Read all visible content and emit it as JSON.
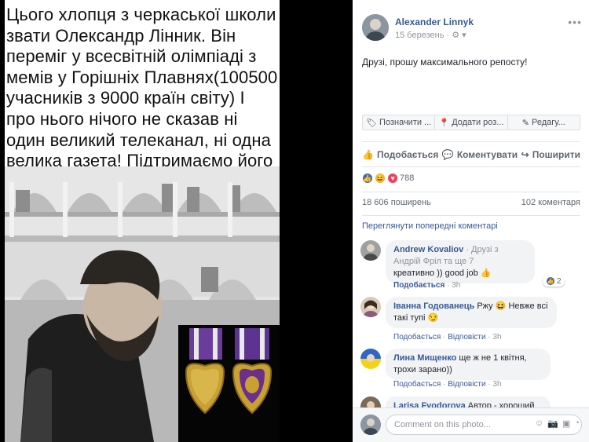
{
  "photo": {
    "caption": "Цього хлопця з черкаської школи звати Олександр Лінник. Він переміг у всесвітній олімпіаді з мемів у Горішніх Плавнях(100500 учасників з 9000 країн світу) І про нього нічого не сказав ні один великий телеканал, ні одна велика газета! Підтримаємо його репостами!"
  },
  "post": {
    "author": "Alexander Linnyk",
    "date": "15 березень",
    "text": "Друзі, прошу максимального репосту!",
    "photo_actions": [
      "Позначити ...",
      "Додати роз...",
      "Редагу..."
    ],
    "like_label": "Подобається",
    "comment_label": "Коментувати",
    "share_label": "Поширити",
    "reaction_count": "788",
    "shares": "18 606 поширень",
    "comments_count": "102 коментаря",
    "prev_comments": "Переглянути попередні коментарі"
  },
  "comments": [
    {
      "name": "Andrew Kovaliov",
      "context": "Друзі з Андрій Фріл та ще 7",
      "text": "креативно )) good job",
      "like": "Подобається",
      "time": "3h",
      "reactions": "2"
    },
    {
      "name": "Іванна Годованець",
      "text_a": "Ржу",
      "text_b": "Невже всі такі тупі",
      "like": "Подобається",
      "reply": "Відповісти",
      "time": "3h"
    },
    {
      "name": "Лина Мищенко",
      "text": "ще ж не 1 квітня, трохи зарано))",
      "like": "Подобається",
      "reply": "Відповісти",
      "time": "3h"
    },
    {
      "name": "Larisa Fyodorova",
      "text": "Автор - хороший"
    }
  ],
  "composer": {
    "placeholder": "Comment on this photo..."
  }
}
